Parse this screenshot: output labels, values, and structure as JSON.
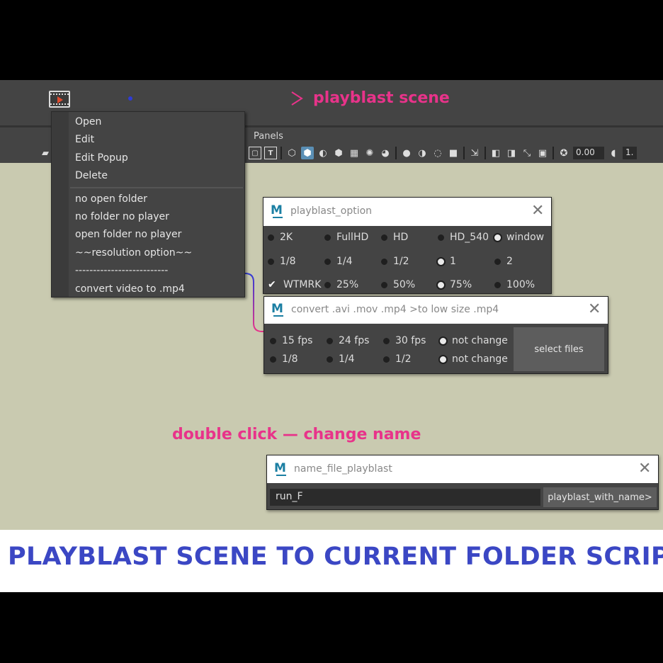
{
  "colors": {
    "annotation": "#e8338a",
    "arrow_blue": "#2f3bd6",
    "banner_text": "#3b47c4",
    "viewport": "#c9cab0"
  },
  "annotations": {
    "playblast_scene": "playblast scene",
    "double_click": "double click — change name"
  },
  "toolbar": {
    "panels_label": "Panels",
    "field1": "0.00",
    "field2": "1."
  },
  "menu": {
    "group1": [
      "Open",
      "Edit",
      "Edit Popup",
      "Delete"
    ],
    "group2": [
      "no open folder",
      "no folder no player",
      "open folder no player",
      "~~resolution option~~",
      "--------------------------",
      "convert video to .mp4"
    ]
  },
  "playblast_option": {
    "title": "playblast_option",
    "close": "✕",
    "rows": [
      [
        {
          "label": "2K",
          "on": false
        },
        {
          "label": "FullHD",
          "on": false
        },
        {
          "label": "HD",
          "on": false
        },
        {
          "label": "HD_540",
          "on": false
        },
        {
          "label": "window",
          "on": true
        }
      ],
      [
        {
          "label": "1/8",
          "on": false
        },
        {
          "label": "1/4",
          "on": false
        },
        {
          "label": "1/2",
          "on": false
        },
        {
          "label": "1",
          "on": true
        },
        {
          "label": "2",
          "on": false
        }
      ],
      [
        {
          "label": "WTMRK",
          "checked": true
        },
        {
          "label": "25%",
          "on": false
        },
        {
          "label": "50%",
          "on": false
        },
        {
          "label": "75%",
          "on": true
        },
        {
          "label": "100%",
          "on": false
        }
      ]
    ]
  },
  "convert": {
    "title": "convert .avi .mov .mp4 >to low size .mp4",
    "close": "✕",
    "rows": [
      [
        {
          "label": "15 fps",
          "on": false
        },
        {
          "label": "24 fps",
          "on": false
        },
        {
          "label": "30 fps",
          "on": false
        },
        {
          "label": "not change",
          "on": true
        }
      ],
      [
        {
          "label": "1/8",
          "on": false
        },
        {
          "label": "1/4",
          "on": false
        },
        {
          "label": "1/2",
          "on": false
        },
        {
          "label": "not change",
          "on": true
        }
      ]
    ],
    "button": "select files"
  },
  "name_window": {
    "title": "name_file_playblast",
    "close": "✕",
    "field_value": "run_F",
    "button": "playblast_with_name>"
  },
  "banner": "PLAYBLAST SCENE TO CURRENT FOLDER SCRIPT"
}
